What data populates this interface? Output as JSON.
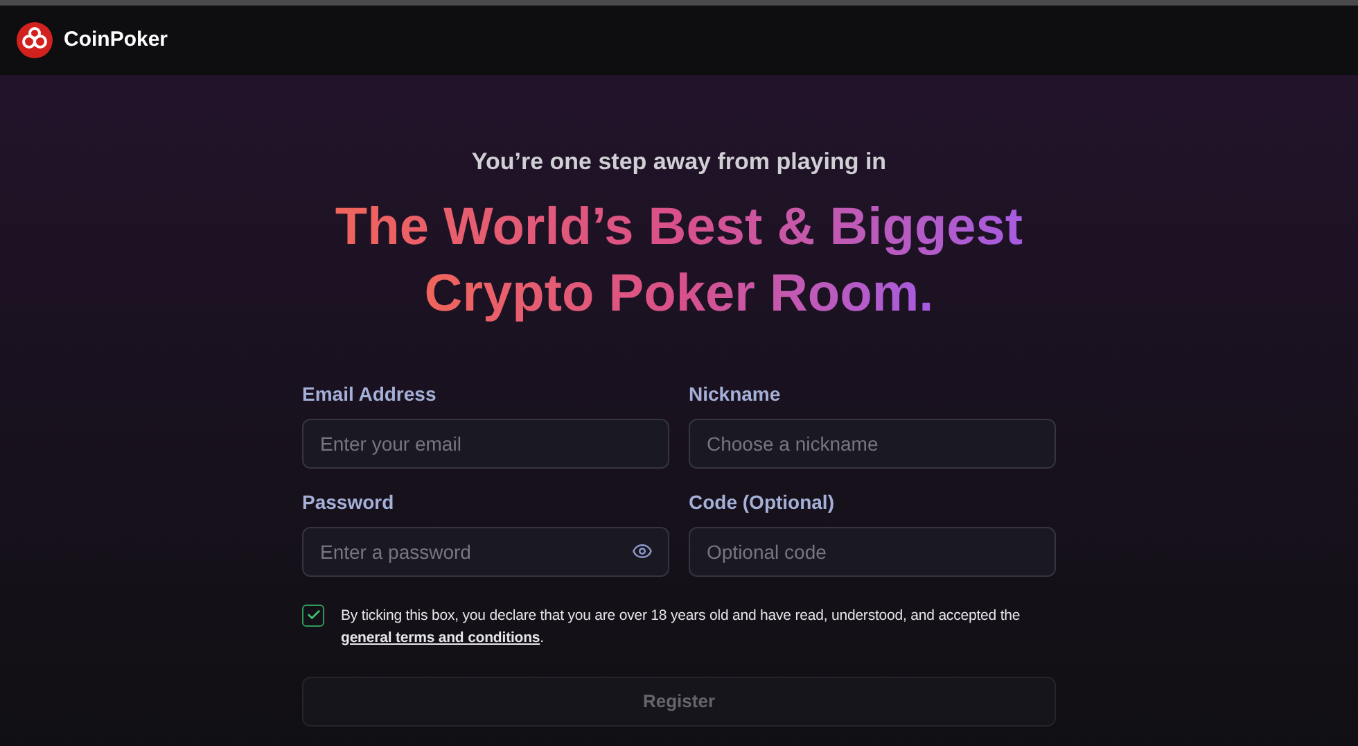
{
  "header": {
    "brand": "CoinPoker"
  },
  "intro": "You’re one step away from playing in",
  "headline": [
    "The World’s Best & Biggest",
    "Crypto Poker Room."
  ],
  "fields": [
    {
      "label": "Email Address",
      "placeholder": "Enter your email",
      "kind": "text"
    },
    {
      "label": "Nickname",
      "placeholder": "Choose a nickname",
      "kind": "text"
    },
    {
      "label": "Password",
      "placeholder": "Enter a password",
      "kind": "password"
    },
    {
      "label": "Code (Optional)",
      "placeholder": "Optional code",
      "kind": "text"
    }
  ],
  "consent": {
    "checked": true,
    "text": "By ticking this box, you declare that you are over 18 years old and have read, understood, and accepted the ",
    "link": "general terms and conditions",
    "end": "."
  },
  "register": {
    "label": "Register",
    "disabled": true
  }
}
